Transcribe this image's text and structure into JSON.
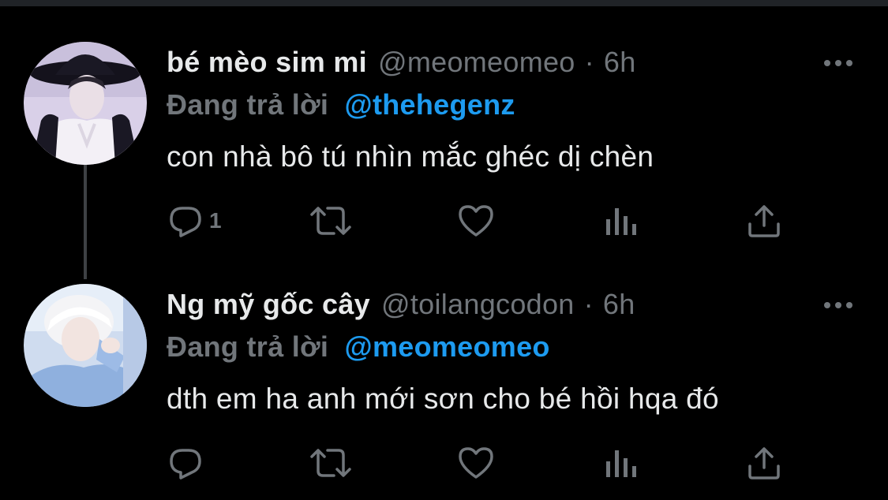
{
  "tweets": [
    {
      "display_name": "bé mèo sim mi",
      "handle": "@meomeomeo",
      "dot": "·",
      "time": "6h",
      "reply_prefix": "Đang trả lời",
      "reply_to": "@thehegenz",
      "text": "con nhà bô tú nhìn mắc ghéc dị chèn",
      "reply_count": "1"
    },
    {
      "display_name": "Ng mỹ gốc cây",
      "handle": "@toilangcodon",
      "dot": "·",
      "time": "6h",
      "reply_prefix": "Đang trả lời",
      "reply_to": "@meomeomeo",
      "text": "dth em ha anh mới sơn cho bé hồi hqa đó",
      "reply_count": ""
    }
  ],
  "icons": {
    "reply": "reply-icon",
    "retweet": "retweet-icon",
    "like": "heart-icon",
    "analytics": "analytics-icon",
    "share": "share-icon",
    "more": "more-icon"
  },
  "colors": {
    "background": "#000000",
    "text": "#e7e9ea",
    "secondary": "#71767b",
    "link": "#1d9bf0",
    "thread_line": "#3e4144"
  }
}
